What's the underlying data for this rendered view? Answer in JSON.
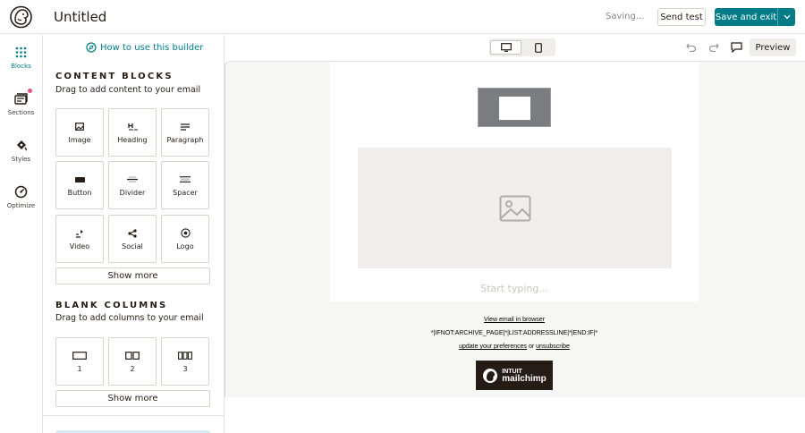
{
  "header": {
    "title": "Untitled",
    "status": "Saving...",
    "send_test_label": "Send test",
    "save_exit_label": "Save and exit"
  },
  "rail": {
    "items": [
      {
        "label": "Blocks",
        "icon": "blocks-grid-icon",
        "active": true
      },
      {
        "label": "Sections",
        "icon": "sections-icon",
        "active": false
      },
      {
        "label": "Styles",
        "icon": "styles-palette-icon",
        "active": false
      },
      {
        "label": "Optimize",
        "icon": "optimize-gauge-icon",
        "active": false
      }
    ]
  },
  "panel": {
    "howto_label": "How to use this builder",
    "content_blocks": {
      "heading": "CONTENT BLOCKS",
      "subheading": "Drag to add content to your email",
      "tiles": [
        {
          "label": "Image",
          "icon": "image-icon"
        },
        {
          "label": "Heading",
          "icon": "heading-icon"
        },
        {
          "label": "Paragraph",
          "icon": "paragraph-icon"
        },
        {
          "label": "Button",
          "icon": "button-icon"
        },
        {
          "label": "Divider",
          "icon": "divider-icon"
        },
        {
          "label": "Spacer",
          "icon": "spacer-icon"
        },
        {
          "label": "Video",
          "icon": "video-icon"
        },
        {
          "label": "Social",
          "icon": "social-share-icon"
        },
        {
          "label": "Logo",
          "icon": "logo-icon"
        }
      ],
      "show_more_label": "Show more"
    },
    "blank_columns": {
      "heading": "BLANK COLUMNS",
      "subheading": "Drag to add columns to your email",
      "tiles": [
        {
          "label": "1",
          "icon": "one-column-icon"
        },
        {
          "label": "2",
          "icon": "two-column-icon"
        },
        {
          "label": "3",
          "icon": "three-column-icon"
        }
      ],
      "show_more_label": "Show more"
    }
  },
  "toolbar": {
    "preview_label": "Preview",
    "device_active": "desktop"
  },
  "email": {
    "placeholder_text": "Start typing...",
    "footer": {
      "view_in_browser": "View email in browser",
      "address_merge": "*|IFNOT:ARCHIVE_PAGE|*|LIST:ADDRESSLINE|*|END:IF|*",
      "update_prefs": "update your preferences",
      "or_text": "or",
      "unsubscribe": "unsubscribe"
    },
    "badge": {
      "line1": "INTUIT",
      "line2": "mailchimp"
    }
  },
  "colors": {
    "accent": "#007c89",
    "brand_dark": "#241c15",
    "canvas_bg": "#f6f6f4",
    "notification_dot": "#e8508a"
  }
}
